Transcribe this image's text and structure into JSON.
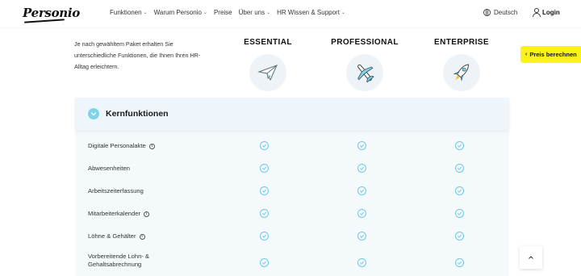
{
  "header": {
    "logo": "Personio",
    "nav": [
      {
        "label": "Funktionen",
        "dropdown": true
      },
      {
        "label": "Warum Personio",
        "dropdown": true
      },
      {
        "label": "Preise",
        "dropdown": false
      },
      {
        "label": "Über uns",
        "dropdown": true
      },
      {
        "label": "HR Wissen & Support",
        "dropdown": true
      }
    ],
    "language": "Deutsch",
    "login": "Login"
  },
  "intro": "Je nach gewähltem Paket erhalten Sie unterschiedliche Funktionen, die Ihnen Ihren HR-Alltag erleichtern.",
  "plans": [
    {
      "name": "ESSENTIAL",
      "icon": "paper-plane-icon"
    },
    {
      "name": "PROFESSIONAL",
      "icon": "airplane-icon"
    },
    {
      "name": "ENTERPRISE",
      "icon": "rocket-icon"
    }
  ],
  "calc_tab": "Preis berechnen",
  "features": {
    "title": "Kernfunktionen",
    "rows": [
      {
        "label": "Digitale Personalakte",
        "info": true,
        "essential": true,
        "professional": true,
        "enterprise": true
      },
      {
        "label": "Abwesenheiten",
        "info": false,
        "essential": true,
        "professional": true,
        "enterprise": true
      },
      {
        "label": "Arbeitszeiterfassung",
        "info": false,
        "essential": true,
        "professional": true,
        "enterprise": true
      },
      {
        "label": "Mitarbeiterkalender",
        "info": true,
        "essential": true,
        "professional": true,
        "enterprise": true
      },
      {
        "label": "Löhne & Gehälter",
        "info": true,
        "essential": true,
        "professional": true,
        "enterprise": true
      },
      {
        "label_line1": "Vorbereitende Lohn- &",
        "label_line2": "Gehaltsabrechnung",
        "info": false,
        "essential": true,
        "professional": true,
        "enterprise": true
      }
    ]
  },
  "colors": {
    "accent": "#6fc9e3",
    "tab": "#fbf21c",
    "panel": "#f4f9fc"
  }
}
